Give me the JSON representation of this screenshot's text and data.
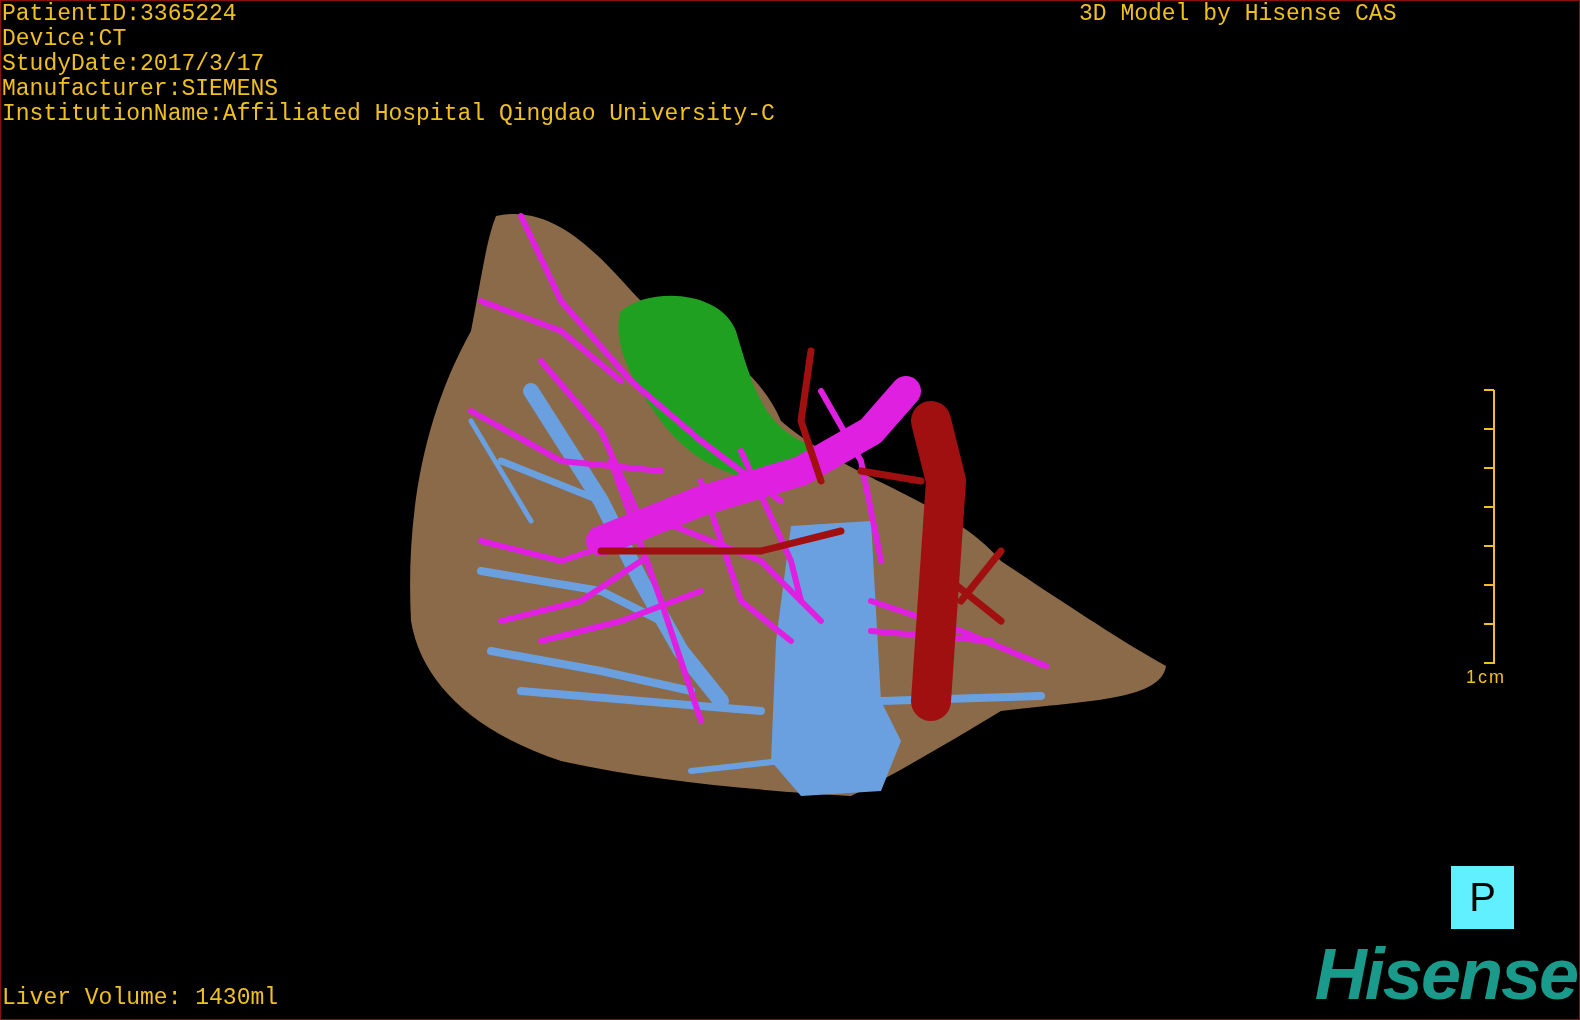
{
  "header": {
    "lines": [
      "PatientID:3365224",
      "Device:CT",
      "StudyDate:2017/3/17",
      "Manufacturer:SIEMENS",
      "InstitutionName:Affiliated Hospital Qingdao University-C"
    ],
    "credit": "3D Model by Hisense CAS"
  },
  "scale_bar": {
    "label": "1cm"
  },
  "orientation_marker": "P",
  "liver_volume": "Liver Volume: 1430ml",
  "logo": "Hisense"
}
